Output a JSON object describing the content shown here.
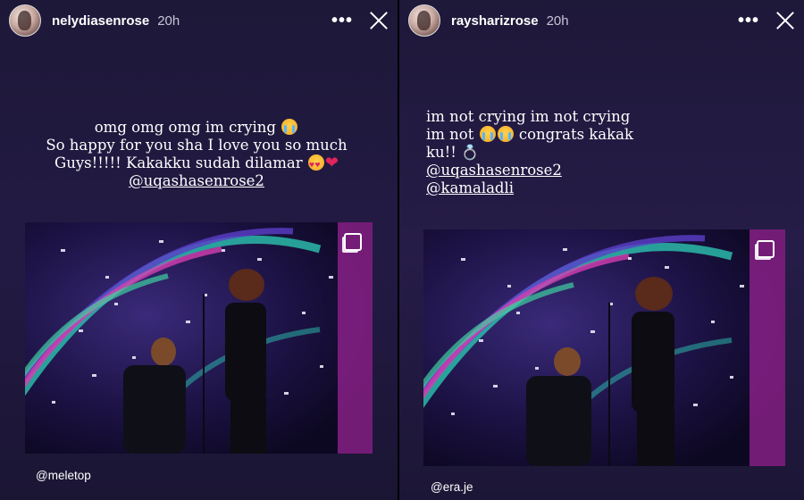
{
  "left_story": {
    "username": "nelydiasenrose",
    "time": "20h",
    "caption": {
      "line1": "omg omg omg im crying",
      "line2": "So happy for you sha I love you so much",
      "line3": "Guys!!!!! Kakakku sudah dilamar",
      "mention": "@uqashasenrose2"
    },
    "source": "@meletop"
  },
  "right_story": {
    "username": "rayshariz­rose",
    "time": "20h",
    "caption": {
      "line1": "im not crying im not crying",
      "line2a": "im not",
      "line2b": "congrats kakak",
      "line3": "ku!!",
      "mention1": "@uqashasenrose2",
      "mention2": "@kamaladli"
    },
    "source": "@era.je"
  },
  "icons": {
    "more": "more-options-icon",
    "close": "close-icon",
    "multi": "multiple-posts-icon"
  },
  "colors": {
    "background": "#221a42",
    "text": "#ffffff",
    "secondary_text": "#c8c4d6"
  }
}
